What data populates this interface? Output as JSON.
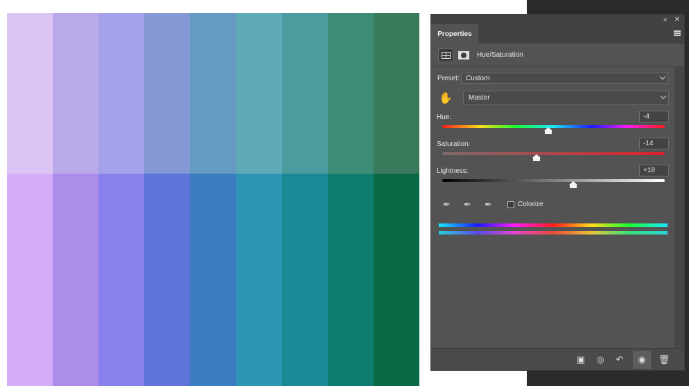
{
  "canvas": {
    "top_row_colors": [
      "#dcc4f4",
      "#bbaaea",
      "#a4a2e8",
      "#8598d6",
      "#659ac2",
      "#5faab8",
      "#4a9c9e",
      "#3e8c78",
      "#3a7a5c"
    ],
    "bottom_row_colors": [
      "#d6aef8",
      "#ac8eea",
      "#8a82ec",
      "#5e74d8",
      "#3c7cc0",
      "#2e96b4",
      "#1a8a96",
      "#0e7c6e",
      "#0a6844"
    ]
  },
  "panel": {
    "tab_label": "Properties",
    "adjustment_title": "Hue/Saturation",
    "preset_label": "Preset:",
    "preset_value": "Custom",
    "channel_value": "Master",
    "hue": {
      "label": "Hue:",
      "value": "-4",
      "position": 0.478
    },
    "saturation": {
      "label": "Saturation:",
      "value": "-14",
      "position": 0.425
    },
    "lightness": {
      "label": "Lightness:",
      "value": "+18",
      "position": 0.588
    },
    "colorize_label": "Colorize",
    "colorize_checked": false
  },
  "icons": {
    "collapse": "double-chevron-left-icon",
    "close": "close-icon",
    "menu": "hamburger-menu-icon",
    "adjustment": "adjustment-grid-icon",
    "mask": "layer-mask-icon",
    "hand": "targeted-adjustment-hand-icon",
    "eyedroppers": [
      "eyedropper-icon",
      "eyedropper-plus-icon",
      "eyedropper-minus-icon"
    ],
    "bottom": [
      "clip-to-layer-icon",
      "view-previous-icon",
      "reset-icon",
      "visibility-eye-icon",
      "trash-icon"
    ]
  },
  "colors": {
    "panel_bg": "#535353",
    "panel_dark": "#424242",
    "workspace_dark": "#2b2b2b"
  }
}
